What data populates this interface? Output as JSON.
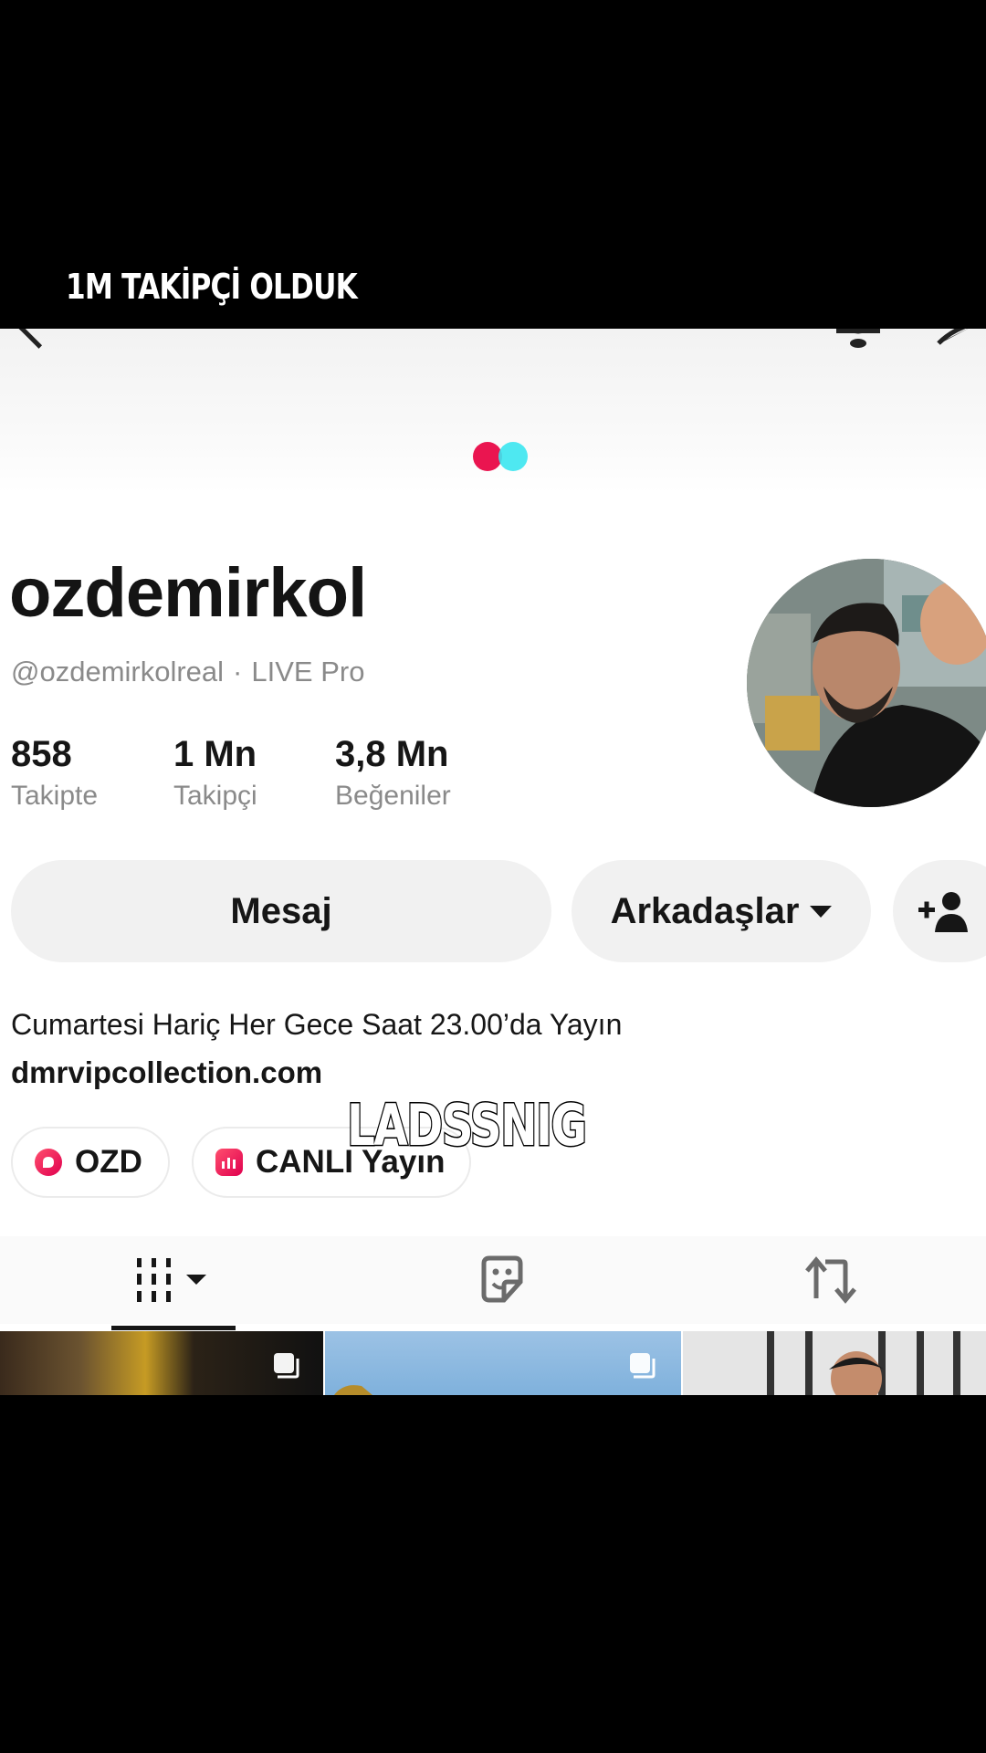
{
  "video": {
    "top_caption": "1M TAKİPÇİ OLDUK",
    "overlay_caption": "LADSSNIG"
  },
  "profile": {
    "display_name": "ozdemirkol",
    "handle": "@ozdemirkolreal",
    "separator": "·",
    "badge": "LIVE Pro",
    "stats": [
      {
        "value": "858",
        "label": "Takipte"
      },
      {
        "value": "1 Mn",
        "label": "Takipçi"
      },
      {
        "value": "3,8 Mn",
        "label": "Beğeniler"
      }
    ],
    "buttons": {
      "message": "Mesaj",
      "friends": "Arkadaşlar"
    },
    "bio": "Cumartesi Hariç Her Gece Saat 23.00’da Yayın",
    "link": "dmrvipcollection.com",
    "chips": [
      {
        "label": "OZD"
      },
      {
        "label": "CANLI Yayın"
      }
    ]
  },
  "colors": {
    "brand_red": "#ea1550",
    "brand_cyan": "#3be5ef"
  },
  "icons": {
    "back": "back-icon",
    "bell": "bell-icon",
    "share": "share-icon",
    "add_friend": "add-friend-icon",
    "posts_tab": "grid-icon",
    "favorites_tab": "sticker-icon",
    "reposts_tab": "repost-icon"
  }
}
